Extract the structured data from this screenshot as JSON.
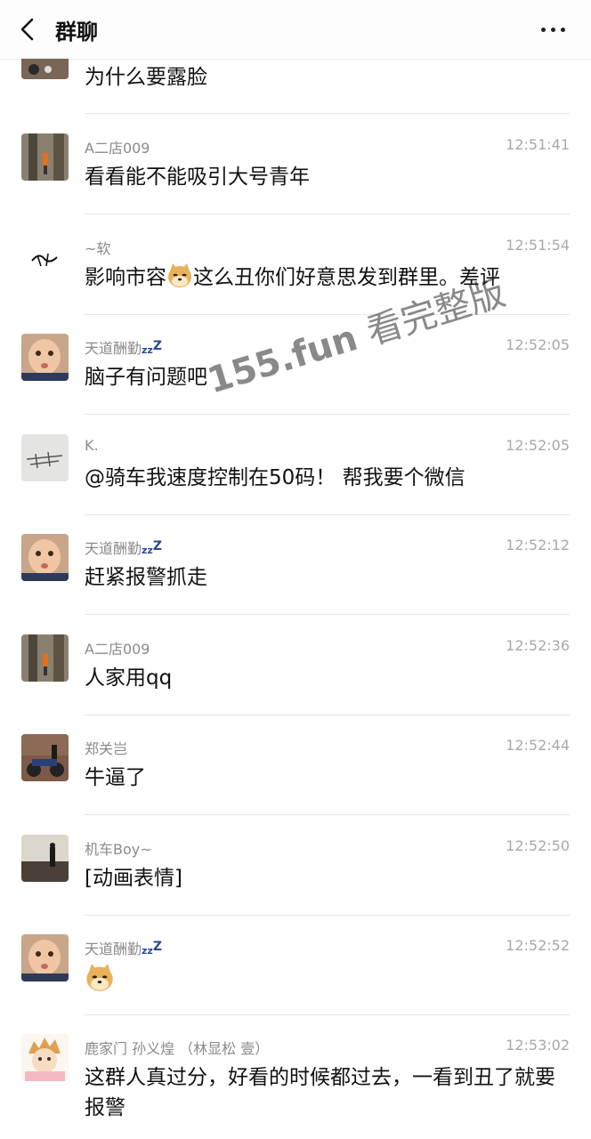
{
  "header": {
    "title": "群聊"
  },
  "watermark": {
    "site": "155.fun",
    "text": "看完整版"
  },
  "messages": [
    {
      "name": "",
      "time": "",
      "text": "为什么要露脸"
    },
    {
      "name": "A二店009",
      "time": "12:51:41",
      "text": "看看能不能吸引大号青年"
    },
    {
      "name": "~软",
      "time": "12:51:54",
      "text_before": "影响市容",
      "emoji": "doge-emoji",
      "text_after": "这么丑你们好意思发到群里。差评"
    },
    {
      "name": "天道酬勤",
      "name_suffix": "zz",
      "name_suffix2": "Z",
      "time": "12:52:05",
      "text": "脑子有问题吧"
    },
    {
      "name": "K.",
      "time": "12:52:05",
      "text": "@骑车我速度控制在50码！ 帮我要个微信"
    },
    {
      "name": "天道酬勤",
      "name_suffix": "zz",
      "name_suffix2": "Z",
      "time": "12:52:12",
      "text": "赶紧报警抓走"
    },
    {
      "name": "A二店009",
      "time": "12:52:36",
      "text": "人家用qq"
    },
    {
      "name": "郑关岂",
      "time": "12:52:44",
      "text": "牛逼了"
    },
    {
      "name": "机车Boy~",
      "time": "12:52:50",
      "text": "[动画表情]"
    },
    {
      "name": "天道酬勤",
      "name_suffix": "zz",
      "name_suffix2": "Z",
      "time": "12:52:52",
      "emoji": "doge-emoji"
    },
    {
      "name": "鹿家门 孙义煌 （林显松 壹）",
      "time": "12:53:02",
      "text": "这群人真过分，好看的时候都过去，一看到丑了就要报警"
    }
  ],
  "icons": {
    "back": "chevron-left-icon",
    "more": "more-dots-icon",
    "emoji": "doge-emoji"
  }
}
